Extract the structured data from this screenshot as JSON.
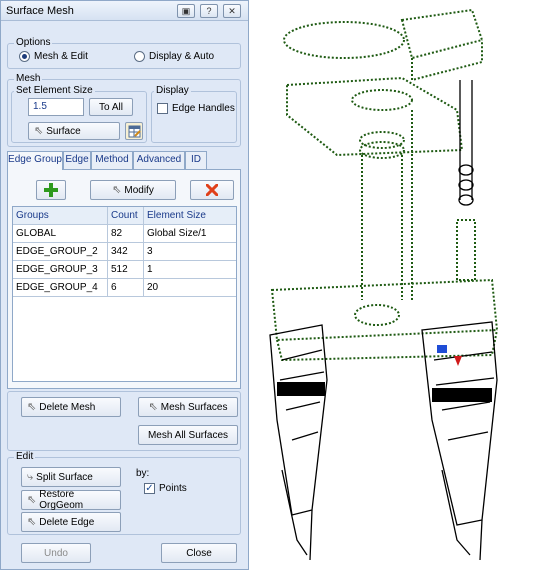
{
  "window": {
    "title": "Surface Mesh",
    "buttons": [
      "▣",
      "?",
      "✕"
    ]
  },
  "options": {
    "legend": "Options",
    "mode_mesh_edit": "Mesh & Edit",
    "mode_display_auto": "Display & Auto",
    "selected": "Mesh & Edit"
  },
  "mesh": {
    "legend": "Mesh",
    "set_element_size_legend": "Set Element Size",
    "element_size_value": "1.5",
    "to_all_label": "To All",
    "surface_label": "Surface",
    "display_legend": "Display",
    "edge_handles_label": "Edge Handles",
    "edge_handles_checked": false
  },
  "tabs": [
    "Edge Group",
    "Edge",
    "Method",
    "Advanced",
    "ID"
  ],
  "active_tab": "Edge Group",
  "edge_group": {
    "modify_label": "Modify",
    "columns": [
      "Groups",
      "Count",
      "Element Size"
    ],
    "rows": [
      [
        "GLOBAL",
        "82",
        "Global Size/1"
      ],
      [
        "EDGE_GROUP_2",
        "342",
        "3"
      ],
      [
        "EDGE_GROUP_3",
        "512",
        "1"
      ],
      [
        "EDGE_GROUP_4",
        "6",
        "20"
      ]
    ]
  },
  "actions": {
    "delete_mesh_label": "Delete Mesh",
    "mesh_surfaces_label": "Mesh Surfaces",
    "mesh_all_surfaces_label": "Mesh All Surfaces"
  },
  "edit": {
    "legend": "Edit",
    "split_surface_label": "Split Surface",
    "restore_orggeom_label": "Restore OrgGeom",
    "delete_edge_label": "Delete Edge",
    "by_label": "by:",
    "points_label": "Points",
    "points_checked": true
  },
  "footer": {
    "undo_label": "Undo",
    "close_label": "Close"
  },
  "colors": {
    "panel_bg": "#dfe8f6",
    "mesh_green": "#1e5a12",
    "add_green": "#2e9a1e",
    "delete_red": "#e0401a"
  }
}
